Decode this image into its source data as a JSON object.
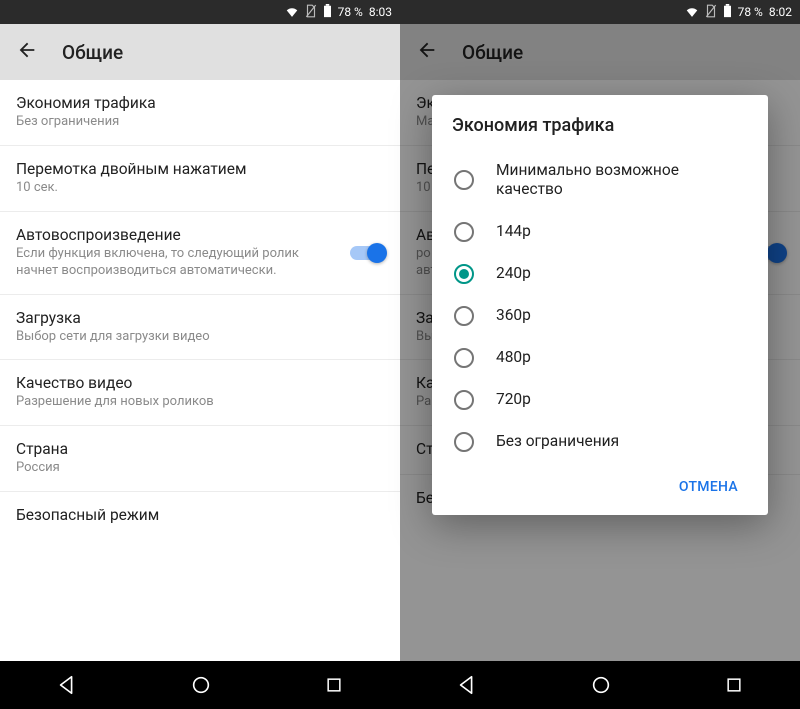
{
  "left": {
    "status": {
      "battery": "78 %",
      "time": "8:03"
    },
    "appbar_title": "Общие",
    "rows": {
      "traffic": {
        "title": "Экономия трафика",
        "sub": "Без ограничения"
      },
      "seek": {
        "title": "Перемотка двойным нажатием",
        "sub": "10 сек."
      },
      "autoplay": {
        "title": "Автовоспроизведение",
        "sub": "Если функция включена, то следующий ролик начнет воспроизводиться автоматически."
      },
      "download": {
        "title": "Загрузка",
        "sub": "Выбор сети для загрузки видео"
      },
      "quality": {
        "title": "Качество видео",
        "sub": "Разрешение для новых роликов"
      },
      "country": {
        "title": "Страна",
        "sub": "Россия"
      },
      "safe": {
        "title": "Безопасный режим"
      }
    }
  },
  "right": {
    "status": {
      "battery": "78 %",
      "time": "8:02"
    },
    "appbar_title": "Общие",
    "bg_rows": {
      "r0": {
        "title": "Эк",
        "sub": "Ма"
      },
      "r1": {
        "title": "Пе",
        "sub": "10"
      },
      "r2": {
        "title": "Ав",
        "sub": "ро\nавт"
      },
      "r3": {
        "title": "За",
        "sub": "Вы"
      },
      "r4": {
        "title": "Ка",
        "sub": "Ра"
      },
      "r5": {
        "title": "Ст",
        "sub": ""
      },
      "r6": {
        "title": "Безопасный режим"
      }
    },
    "dialog": {
      "title": "Экономия трафика",
      "options": {
        "o0": "Минимально возможное качество",
        "o1": "144p",
        "o2": "240p",
        "o3": "360p",
        "o4": "480p",
        "o5": "720p",
        "o6": "Без ограничения"
      },
      "selected_index": 2,
      "cancel": "ОТМЕНА"
    }
  }
}
